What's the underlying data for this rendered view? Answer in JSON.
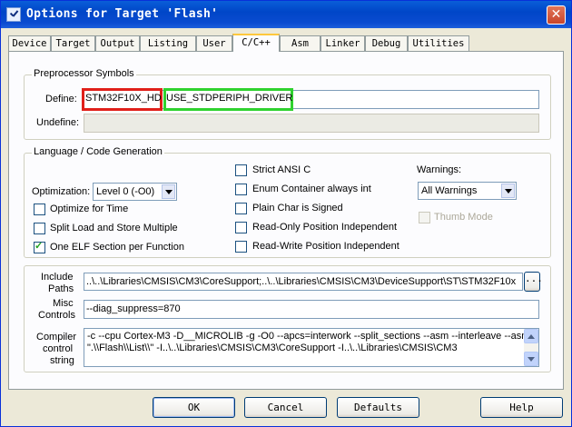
{
  "window": {
    "title": "Options for Target 'Flash'",
    "close_glyph": "✕"
  },
  "tabs": [
    {
      "label": "Device"
    },
    {
      "label": "Target"
    },
    {
      "label": "Output"
    },
    {
      "label": "Listing"
    },
    {
      "label": "User"
    },
    {
      "label": "C/C++"
    },
    {
      "label": "Asm"
    },
    {
      "label": "Linker"
    },
    {
      "label": "Debug"
    },
    {
      "label": "Utilities"
    }
  ],
  "preprocessor": {
    "title": "Preprocessor Symbols",
    "define_label": "Define:",
    "define_value_a": "STM32F10X_HD",
    "define_value_b": "USE_STDPERIPH_DRIVER",
    "undefine_label": "Undefine:",
    "undefine_value": ""
  },
  "language": {
    "title": "Language / Code Generation",
    "optimization_label": "Optimization:",
    "optimization_value": "Level 0 (-O0)",
    "optimize_time": "Optimize for Time",
    "split_load": "Split Load and Store Multiple",
    "one_elf": "One ELF Section per Function",
    "strict_ansi": "Strict ANSI C",
    "enum_container": "Enum Container always int",
    "plain_char": "Plain Char is Signed",
    "ro_pi": "Read-Only Position Independent",
    "rw_pi": "Read-Write Position Independent",
    "warnings_label": "Warnings:",
    "warnings_value": "All Warnings",
    "thumb_mode": "Thumb Mode"
  },
  "paths": {
    "include_label_1": "Include",
    "include_label_2": "Paths",
    "include_value": "..\\..\\Libraries\\CMSIS\\CM3\\CoreSupport;..\\..\\Libraries\\CMSIS\\CM3\\DeviceSupport\\ST\\STM32F10x",
    "browse_label": "...",
    "misc_label_1": "Misc",
    "misc_label_2": "Controls",
    "misc_value": "--diag_suppress=870",
    "compiler_label_1": "Compiler",
    "compiler_label_2": "control",
    "compiler_label_3": "string",
    "compiler_line_1": "-c --cpu Cortex-M3 -D__MICROLIB -g -O0 --apcs=interwork --split_sections --asm --interleave --asm_dir",
    "compiler_line_2": "\".\\\\Flash\\\\List\\\\\" -I..\\..\\Libraries\\CMSIS\\CM3\\CoreSupport -I..\\..\\Libraries\\CMSIS\\CM3"
  },
  "buttons": {
    "ok": "OK",
    "cancel": "Cancel",
    "defaults": "Defaults",
    "help": "Help"
  },
  "colors": {
    "highlight_red": "#e0201a",
    "highlight_green": "#2fd22f",
    "titlebar": "#0a4bd0"
  }
}
